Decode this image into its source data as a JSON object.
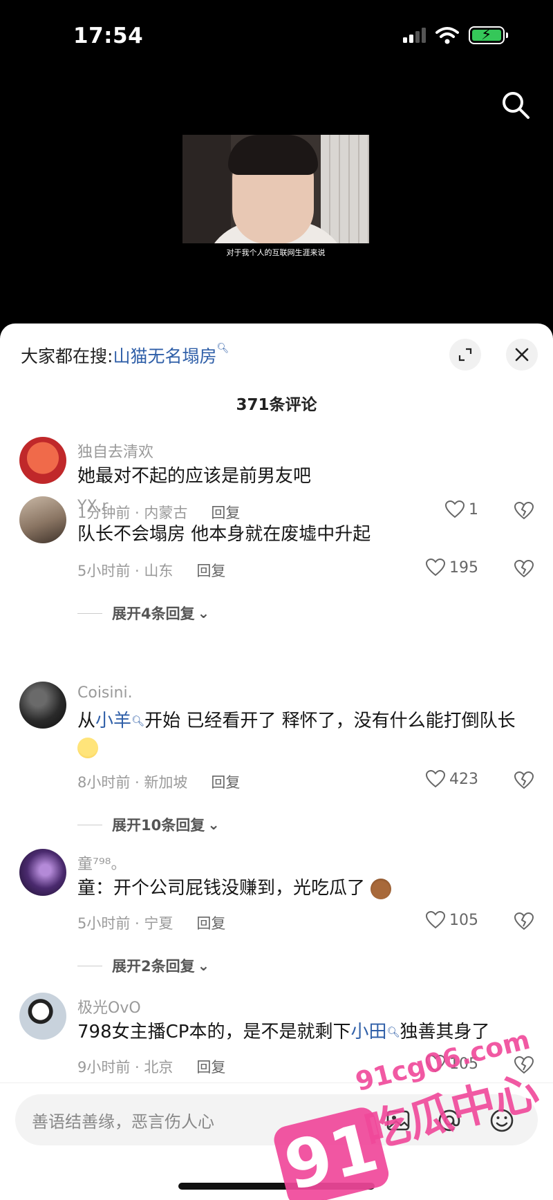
{
  "status_bar": {
    "time": "17:54"
  },
  "video": {
    "caption": "对于我个人的互联网生涯来说"
  },
  "panel": {
    "hot_search_prefix": "大家都在搜:",
    "hot_search_keyword": "山猫无名塌房",
    "comment_count": "371条评论"
  },
  "comments": [
    {
      "user": "独自去清欢",
      "text": "她最对不起的应该是前男友吧",
      "time_loc": "1分钟前 · 内蒙古",
      "reply": "回复",
      "likes": "1"
    },
    {
      "user": "YX.r",
      "text": "队长不会塌房 他本身就在废墟中升起",
      "time_loc": "5小时前 · 山东",
      "reply": "回复",
      "likes": "195",
      "expand": "展开4条回复"
    },
    {
      "user": "Coisini.",
      "text_before": "从",
      "text_link": "小羊",
      "text_after": "开始 已经看开了 释怀了，没有什么能打倒队长",
      "time_loc": "8小时前 · 新加坡",
      "reply": "回复",
      "likes": "423",
      "expand": "展开10条回复"
    },
    {
      "user": "童⁷⁹⁸。",
      "text": "童：开个公司屁钱没赚到，光吃瓜了",
      "time_loc": "5小时前 · 宁夏",
      "reply": "回复",
      "likes": "105",
      "expand": "展开2条回复"
    },
    {
      "user": "极光OvO",
      "text_before": "798女主播CP本的，是不是就剩下",
      "text_link": "小田",
      "text_after": "独善其身了",
      "time_loc": "9小时前 · 北京",
      "reply": "回复",
      "likes": "105"
    }
  ],
  "input": {
    "placeholder": "善语结善缘，恶言伤人心"
  },
  "watermark": {
    "number": "91",
    "site": "91cg06.com",
    "name": "吃瓜中心"
  },
  "colors": {
    "link": "#2f5fa8",
    "watermark": "#f0489a"
  }
}
